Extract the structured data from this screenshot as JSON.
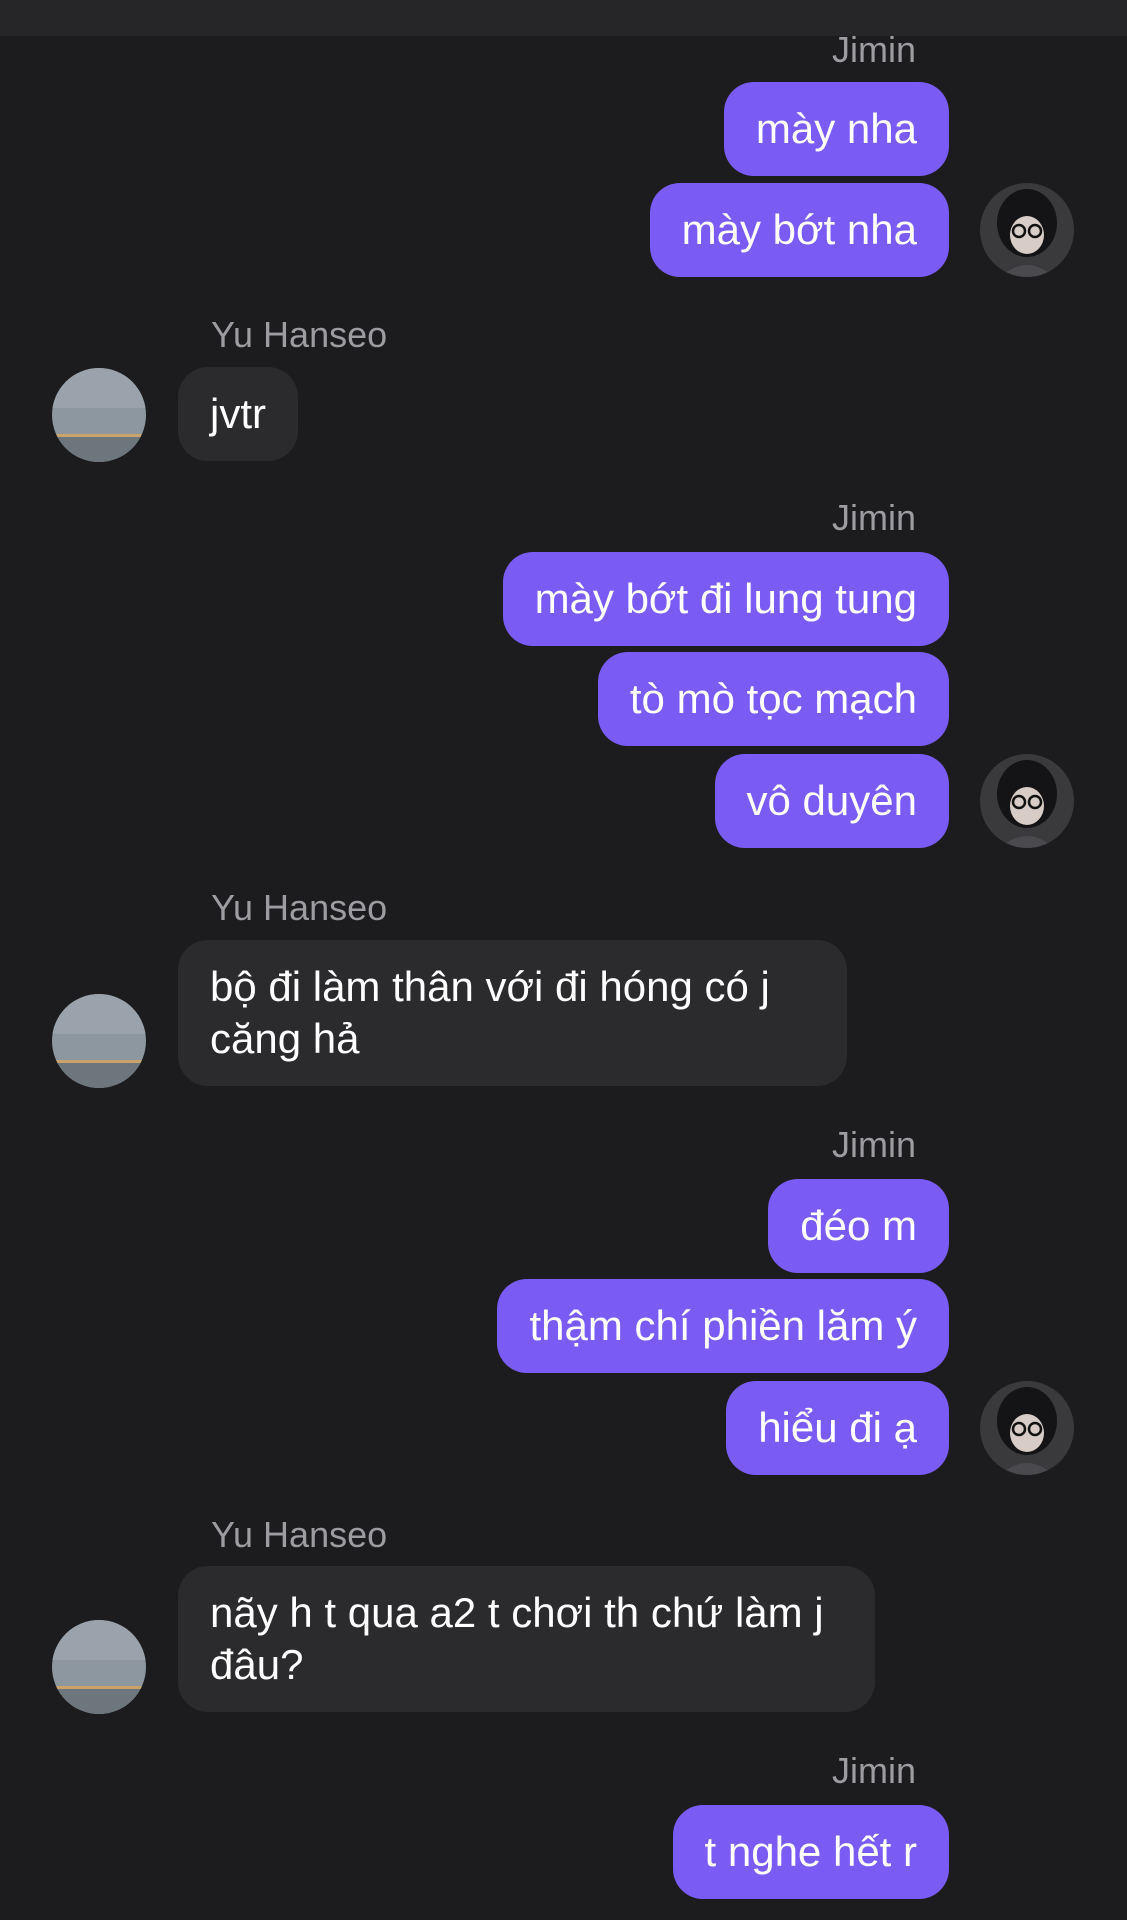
{
  "header": {
    "title": ""
  },
  "participants": {
    "me": {
      "name": "Jimin",
      "avatar": "user-photo-avatar"
    },
    "them": {
      "name": "Yu Hanseo",
      "avatar": "sky-photo-avatar"
    }
  },
  "colors": {
    "background": "#1c1c1e",
    "outgoing_bubble": "#7a5cf5",
    "incoming_bubble": "#2b2b2e",
    "sender_name": "#9c9ca1"
  },
  "groups": [
    {
      "sender": "Jimin",
      "direction": "outgoing",
      "messages": [
        "mày nha",
        "mày bớt nha"
      ]
    },
    {
      "sender": "Yu Hanseo",
      "direction": "incoming",
      "messages": [
        "jvtr"
      ]
    },
    {
      "sender": "Jimin",
      "direction": "outgoing",
      "messages": [
        "mày bớt đi lung tung",
        "tò mò tọc mạch",
        "vô duyên"
      ]
    },
    {
      "sender": "Yu Hanseo",
      "direction": "incoming",
      "messages": [
        "bộ đi làm thân với đi hóng có j căng hả"
      ]
    },
    {
      "sender": "Jimin",
      "direction": "outgoing",
      "messages": [
        "đéo m",
        "thậm chí phiền lăm ý",
        "hiểu đi ạ"
      ]
    },
    {
      "sender": "Yu Hanseo",
      "direction": "incoming",
      "messages": [
        "nãy h t qua a2 t chơi th chứ làm j đâu?"
      ]
    },
    {
      "sender": "Jimin",
      "direction": "outgoing",
      "messages": [
        "t nghe hết r"
      ]
    }
  ]
}
